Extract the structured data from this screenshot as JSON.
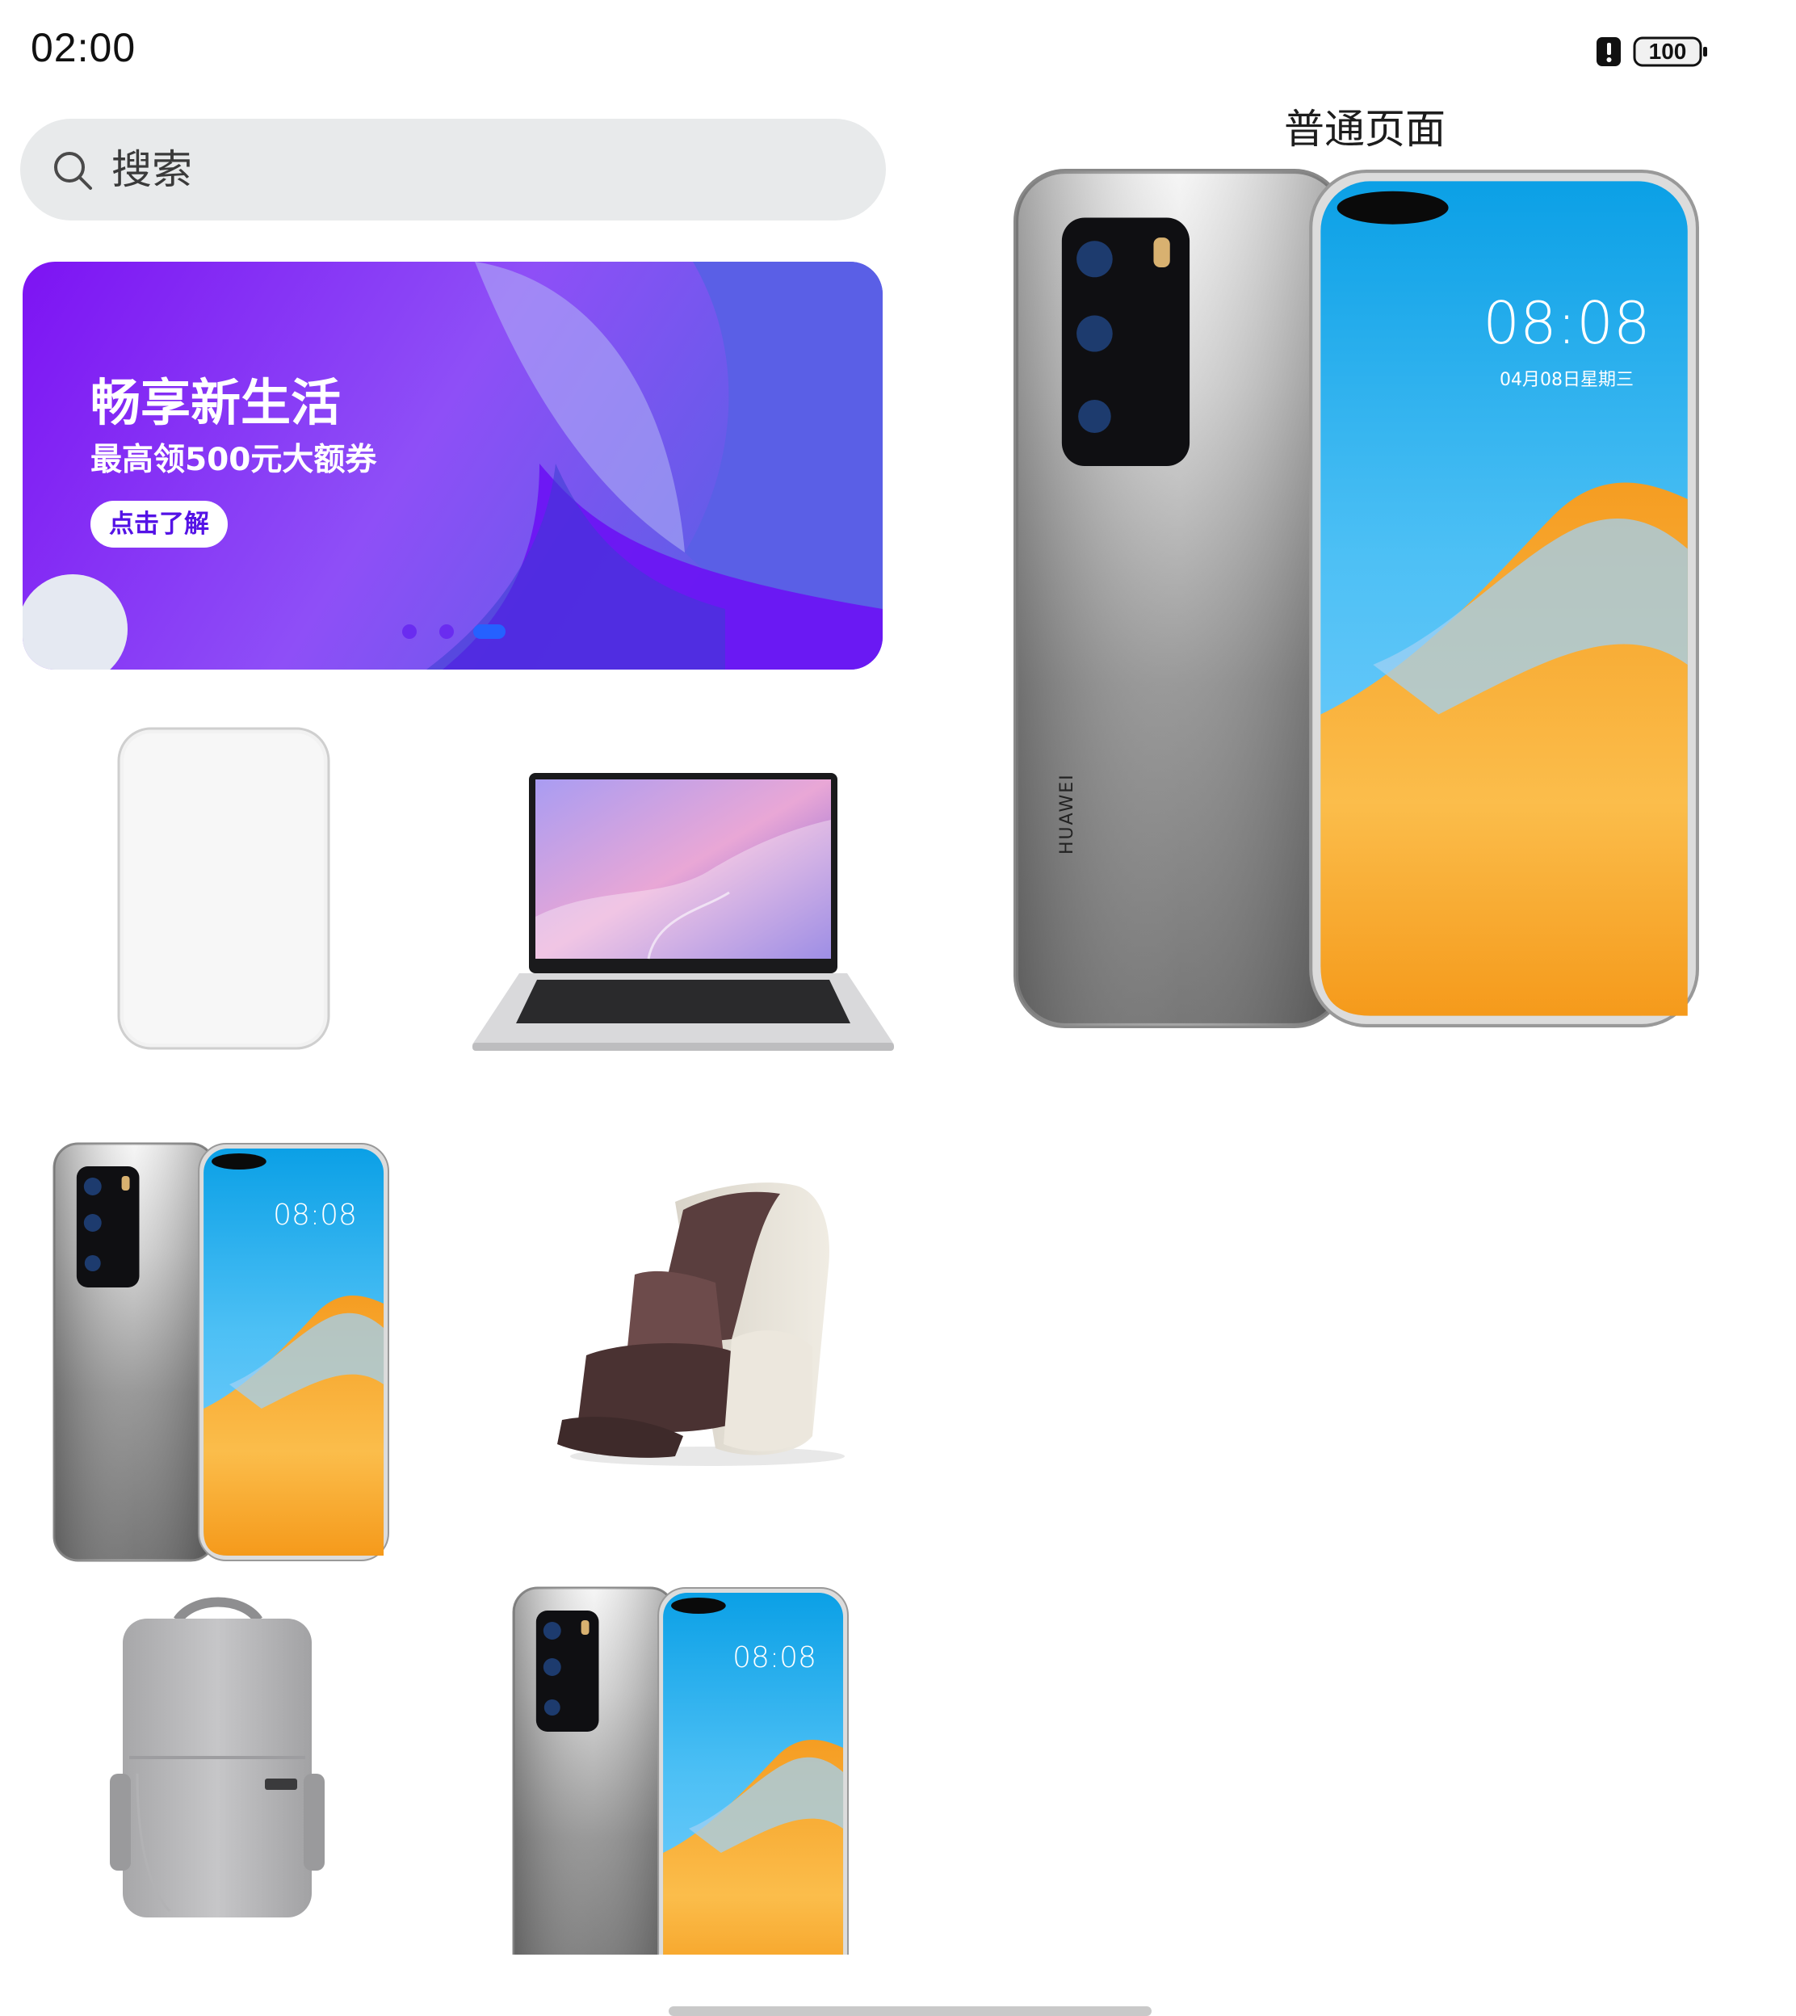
{
  "status_bar": {
    "time": "02:00",
    "battery_level": "100"
  },
  "search": {
    "placeholder": "搜索"
  },
  "banner": {
    "title": "畅享新生活",
    "subtitle": "最高领500元大额券",
    "cta_label": "点击了解",
    "dots_total": 3,
    "active_dot": 3
  },
  "detail": {
    "title": "普通页面",
    "phone_time": "08:08",
    "phone_date": "04月08日星期三",
    "brand": "HUAWEI"
  },
  "grid": {
    "items": [
      {
        "name": "power-bank-image"
      },
      {
        "name": "laptop-image"
      },
      {
        "name": "phone-image",
        "phone_time": "08:08"
      },
      {
        "name": "massage-chair-image"
      },
      {
        "name": "backpack-image"
      },
      {
        "name": "phone-image",
        "phone_time": "08:08"
      }
    ]
  },
  "colors": {
    "banner_start": "#7b1ff2",
    "banner_end": "#4f5ce8",
    "search_bg": "#e8eaeb",
    "accent": "#2561ff"
  }
}
